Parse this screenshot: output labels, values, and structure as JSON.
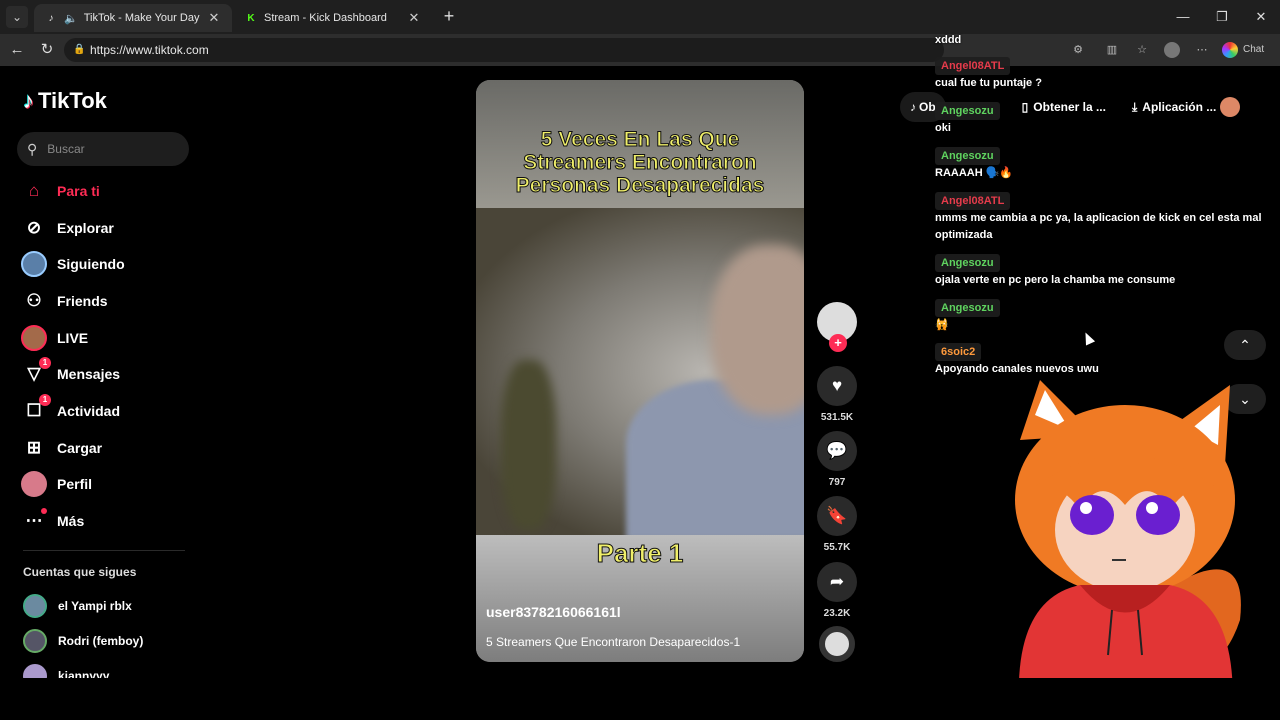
{
  "browser": {
    "tabs": [
      {
        "title": "TikTok - Make Your Day",
        "favicon": "tiktok-icon",
        "active": true
      },
      {
        "title": "Stream - Kick Dashboard",
        "favicon": "kick-icon",
        "active": false
      }
    ],
    "url": "https://www.tiktok.com",
    "chat_label": "Chat"
  },
  "tiktok": {
    "brand": "TikTok",
    "search_placeholder": "Buscar",
    "nav": [
      {
        "label": "Para ti",
        "icon": "home-icon",
        "active": true
      },
      {
        "label": "Explorar",
        "icon": "compass-icon"
      },
      {
        "label": "Siguiendo",
        "icon": "following-avatar-icon"
      },
      {
        "label": "Friends",
        "icon": "friends-icon"
      },
      {
        "label": "LIVE",
        "icon": "live-avatar-icon"
      },
      {
        "label": "Mensajes",
        "icon": "messages-icon",
        "badge": "1"
      },
      {
        "label": "Actividad",
        "icon": "activity-icon",
        "badge": "1"
      },
      {
        "label": "Cargar",
        "icon": "upload-icon"
      },
      {
        "label": "Perfil",
        "icon": "profile-avatar-icon"
      },
      {
        "label": "Más",
        "icon": "more-icon"
      }
    ],
    "following_title": "Cuentas que sigues",
    "following": [
      {
        "name": "el Yampi rblx"
      },
      {
        "name": "Rodri (femboy)"
      },
      {
        "name": "kiannyyy"
      }
    ],
    "topbar": {
      "get_app": "Ob",
      "get_coins": "Obtener la ...",
      "app": "Aplicación ..."
    },
    "video": {
      "headline_lines": [
        "5 Veces En Las Que",
        "Streamers Encontraron",
        "Personas Desaparecidas"
      ],
      "part_label": "Parte 1",
      "username": "user8378216066161l",
      "description": "5 Streamers Que Encontraron Desaparecidos-1"
    },
    "actions": {
      "likes": "531.5K",
      "comments": "797",
      "saves": "55.7K",
      "shares": "23.2K"
    }
  },
  "kick_chat": {
    "messages": [
      {
        "user": "",
        "text": "xddd",
        "color": "none"
      },
      {
        "user": "Angel08ATL",
        "text": "cual fue tu puntaje ?",
        "color": "red"
      },
      {
        "user": "Angesozu",
        "text": "oki",
        "color": "green"
      },
      {
        "user": "Angesozu",
        "text": "RAAAAH 🗣️🔥",
        "color": "green"
      },
      {
        "user": "Angel08ATL",
        "text": "nmms me cambia a pc ya, la aplicacion de kick en cel esta mal optimizada",
        "color": "red"
      },
      {
        "user": "Angesozu",
        "text": "ojala verte en pc pero la chamba me consume",
        "color": "green"
      },
      {
        "user": "Angesozu",
        "text": "🙀",
        "color": "green"
      },
      {
        "user": "6soic2",
        "text": "Apoyando canales nuevos uwu",
        "color": "orange"
      }
    ]
  },
  "colors": {
    "tiktok_red": "#fe2c55",
    "kick_green": "#53fc18",
    "headline_yellow": "#f0ef6a"
  }
}
